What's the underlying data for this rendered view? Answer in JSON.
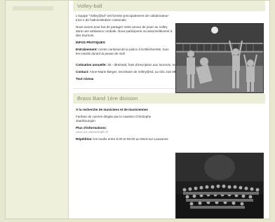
{
  "volley": {
    "title": "Volley-ball",
    "intro": "L'équipe \"Volley@sd\" est formée principalement de collaborateur-trice-s de l'administration cantonale.",
    "desc": "Nous avons pour but de partager notre amour de jouer au volley dans une ambiance cordiale. Nous participons occasionnellement à des tournois.",
    "infos_heading": "INFOS PRATIQUES",
    "training_label": "Entraînement:",
    "training_text": "centre cantonal de la police à la Blécherette, tous les mardis durant la pause de midi",
    "fee_label": "Cotisation annuelle:",
    "fee_text": "25.- dtrs/total; frais d'inscription aux tournois, repas annuel",
    "contact_label": "Contact:",
    "contact_text": "Anne-Marie Berger, secrétaire de Volley@sd, au 021 316 39 21 (du mercredi au vendredi)",
    "level_label": "Tout niveau"
  },
  "brass": {
    "title": "Brass Band 1ère division",
    "heading": "A la recherche de musiciens et de musiciennes",
    "desc": "Fanfare de cuivres dirigée par le maestro Christophe Jeanbourquin",
    "info_label": "Plus d'informations:",
    "info_link": "www.sd-voltestrballl.ch",
    "rep_label": "Répétition:",
    "rep_text": "les lundis entre 8.00 et 09.00 au Mont-sur-Lausanne"
  }
}
